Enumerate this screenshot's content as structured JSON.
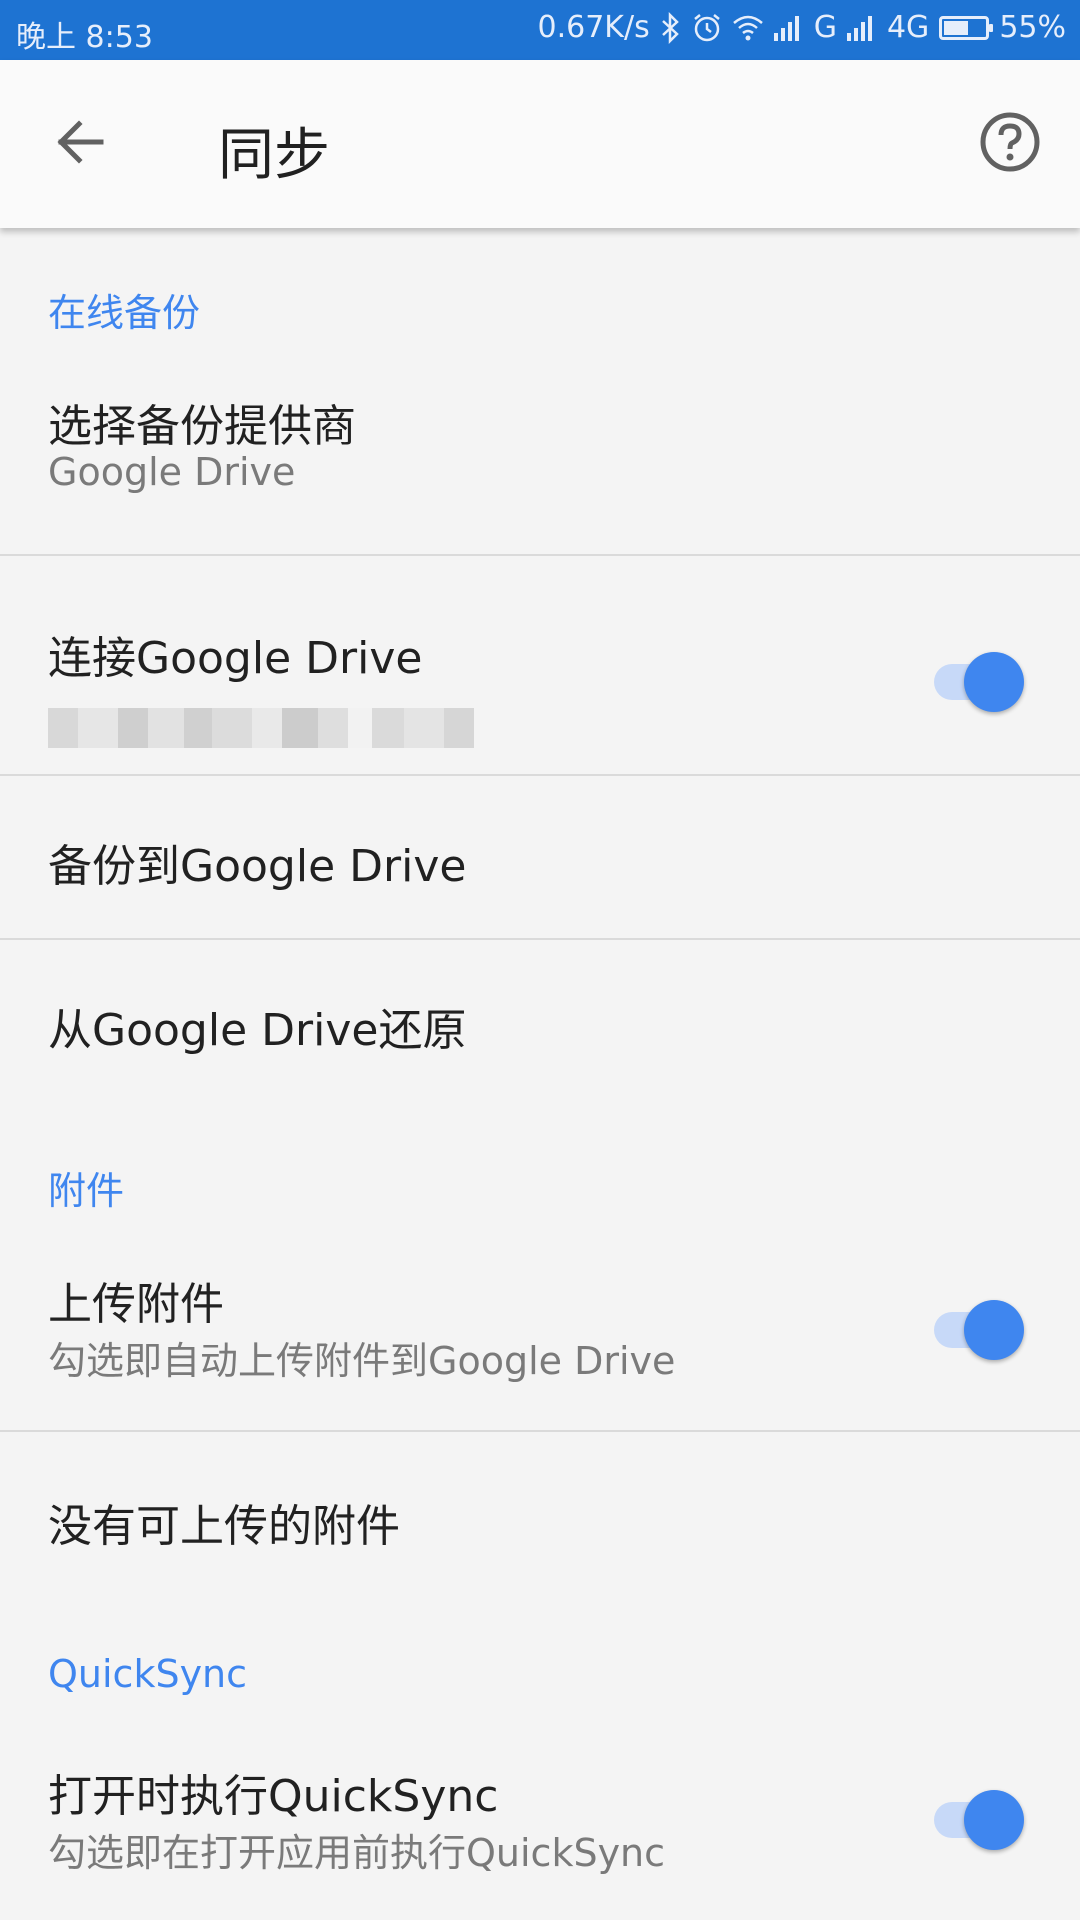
{
  "status_bar": {
    "time": "晚上 8:53",
    "net_speed": "0.67K/s",
    "signal1": "G",
    "signal2": "4G",
    "battery": "55%",
    "battery_level": 0.55
  },
  "app_bar": {
    "title": "同步",
    "back_icon": "arrow-back-icon",
    "help_icon": "help-circle-icon"
  },
  "sections": {
    "online_backup": {
      "header": "在线备份",
      "choose_provider": {
        "title": "选择备份提供商",
        "subtitle": "Google Drive"
      },
      "connect_drive": {
        "title": "连接Google Drive",
        "toggle_on": true
      },
      "backup_to_drive": {
        "title": "备份到Google Drive"
      },
      "restore_from_drive": {
        "title": "从Google Drive还原"
      }
    },
    "attachments": {
      "header": "附件",
      "upload_attachments": {
        "title": "上传附件",
        "subtitle": "勾选即自动上传附件到Google Drive",
        "toggle_on": true
      },
      "no_attachments": {
        "title": "没有可上传的附件"
      }
    },
    "quicksync": {
      "header": "QuickSync",
      "on_open": {
        "title": "打开时执行QuickSync",
        "subtitle": "勾选即在打开应用前执行QuickSync",
        "toggle_on": true
      }
    }
  },
  "colors": {
    "status_bar": "#1e73d2",
    "accent": "#3f86ef",
    "background": "#f4f4f4"
  }
}
